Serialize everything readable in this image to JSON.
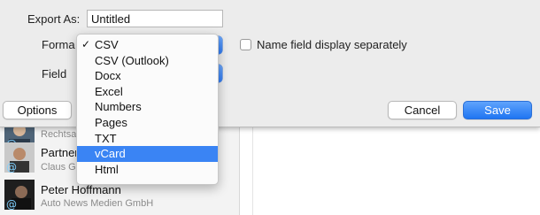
{
  "dialog": {
    "export_label": "Export As:",
    "filename_value": "Untitled",
    "format_label": "Forma",
    "fields_label": "Field",
    "name_separately_label": "Name field display separately",
    "options_button": "Options",
    "cancel_button": "Cancel",
    "save_button": "Save",
    "accent_color": "#2f7cf6"
  },
  "format_menu": {
    "checked_index": 0,
    "highlighted_index": 7,
    "items": [
      {
        "label": "CSV",
        "checked": true
      },
      {
        "label": "CSV (Outlook)"
      },
      {
        "label": "Docx"
      },
      {
        "label": "Excel"
      },
      {
        "label": "Numbers"
      },
      {
        "label": "Pages"
      },
      {
        "label": "TXT"
      },
      {
        "label": "vCard",
        "highlighted": true
      },
      {
        "label": "Html"
      }
    ]
  },
  "contacts": [
    {
      "name": "",
      "company": "Rechtsa"
    },
    {
      "name": "Partner",
      "company": "Claus G"
    },
    {
      "name": "Peter Hoffmann",
      "company": "Auto News Medien GmbH"
    }
  ]
}
